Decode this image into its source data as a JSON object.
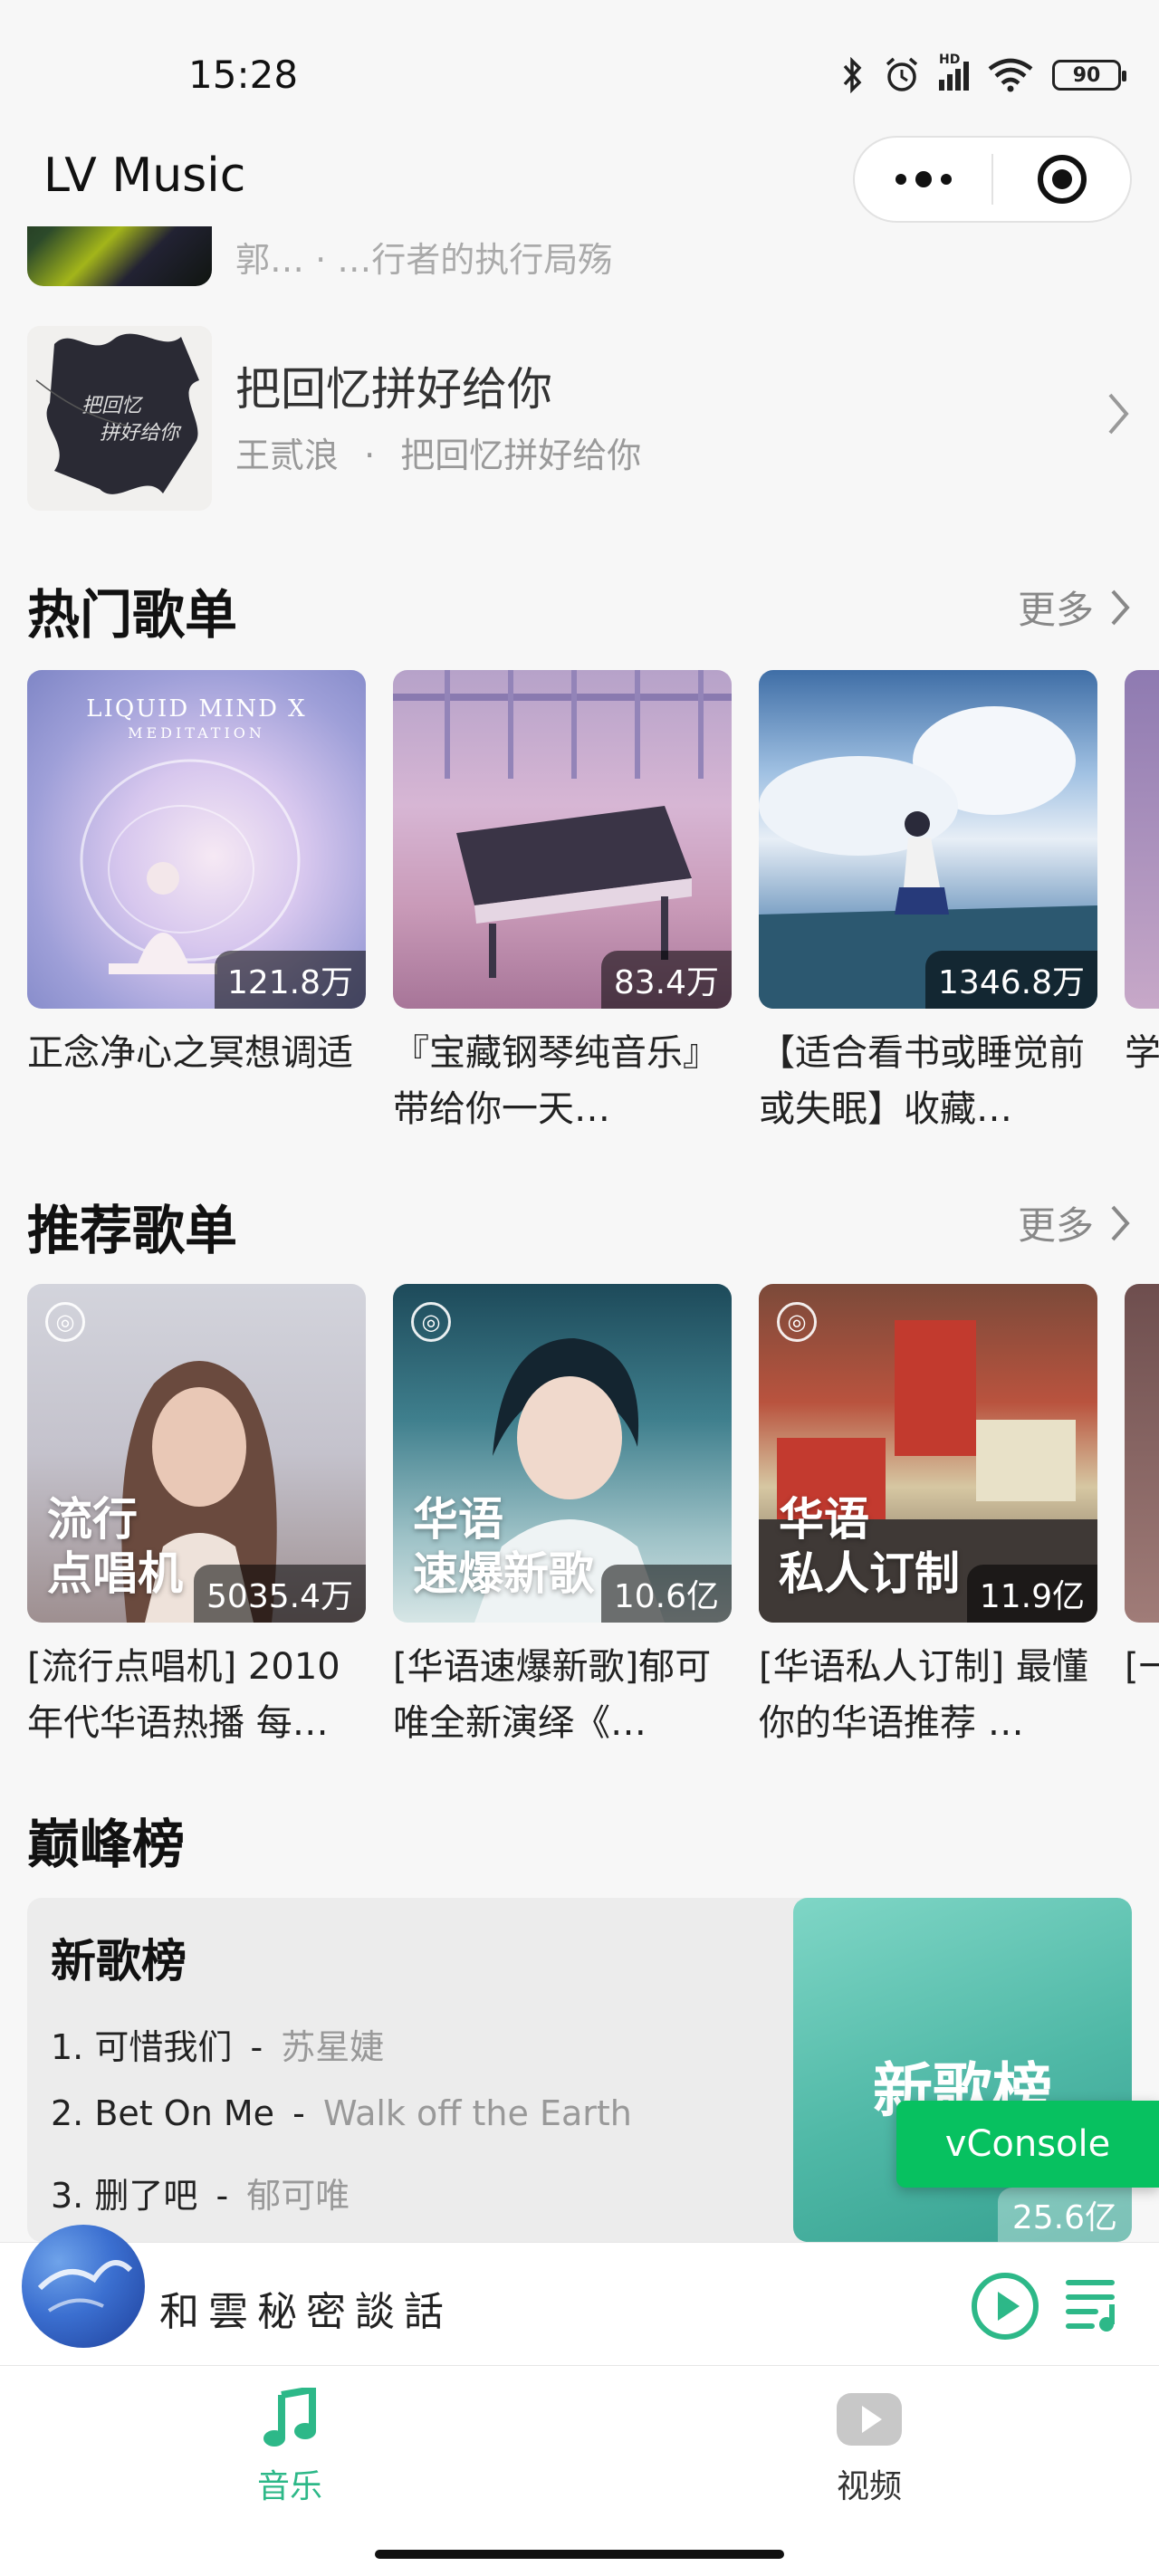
{
  "status_bar": {
    "time": "15:28",
    "battery": "90",
    "network": "HD"
  },
  "app": {
    "title": "LV Music"
  },
  "recent_songs": [
    {
      "title": "",
      "subtitle": "郭… · …行者的执行局殇"
    },
    {
      "title": "把回忆拼好给你",
      "artist": "王贰浪",
      "separator": "·",
      "album": "把回忆拼好给你"
    }
  ],
  "sections": {
    "hot": {
      "title": "热门歌单",
      "more": "更多"
    },
    "recommended": {
      "title": "推荐歌单",
      "more": "更多"
    },
    "charts": {
      "title": "巅峰榜"
    }
  },
  "hot_playlists": [
    {
      "title": "正念净心之冥想调适",
      "count": "121.8万",
      "cover_text": "LIQUID MIND X",
      "cover_sub": "MEDITATION"
    },
    {
      "title": "『宝藏钢琴纯音乐』带给你一天…",
      "count": "83.4万"
    },
    {
      "title": "【适合看书或睡觉前或失眠】收藏…",
      "count": "1346.8万"
    },
    {
      "title": "学…题…",
      "count": ""
    }
  ],
  "recommended_playlists": [
    {
      "title": "[流行点唱机] 2010年代华语热播 每…",
      "count": "5035.4万",
      "overlay_line1": "流行",
      "overlay_line2": "点唱机"
    },
    {
      "title": "[华语速爆新歌]郁可唯全新演绎《…",
      "count": "10.6亿",
      "overlay_line1": "华语",
      "overlay_line2": "速爆新歌"
    },
    {
      "title": "[华语私人订制] 最懂你的华语推荐 …",
      "count": "11.9亿",
      "overlay_line1": "华语",
      "overlay_line2": "私人订制"
    },
    {
      "title": "[一…靓…",
      "count": ""
    }
  ],
  "top_chart": {
    "name": "新歌榜",
    "cover_title": "新歌榜",
    "count": "25.6亿",
    "items": [
      {
        "rank": "1.",
        "song": "可惜我们",
        "dash": "-",
        "artist": "苏星婕"
      },
      {
        "rank": "2.",
        "song": "Bet On Me",
        "dash": "-",
        "artist": "Walk off the Earth"
      },
      {
        "rank": "3.",
        "song": "删了吧",
        "dash": "-",
        "artist": "郁可唯"
      }
    ]
  },
  "vconsole": {
    "label": "vConsole"
  },
  "player": {
    "title": "和雲秘密談話"
  },
  "tabs": [
    {
      "label": "音乐",
      "active": true
    },
    {
      "label": "视频",
      "active": false
    }
  ],
  "colors": {
    "accent": "#2db888",
    "vconsole": "#07c160",
    "background": "#f7f7f7"
  },
  "icons": [
    "bluetooth-icon",
    "alarm-icon",
    "signal-icon",
    "wifi-icon",
    "battery-icon",
    "more-dots-icon",
    "target-icon",
    "chevron-right-icon",
    "netease-logo-icon",
    "play-circle-icon",
    "playlist-icon",
    "music-note-icon",
    "video-play-icon"
  ]
}
